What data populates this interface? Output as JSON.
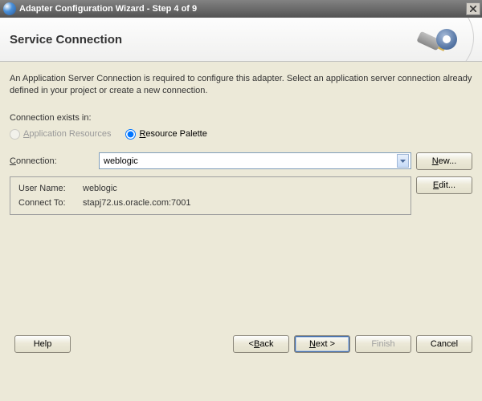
{
  "window": {
    "title": "Adapter Configuration Wizard - Step 4 of 9"
  },
  "banner": {
    "heading": "Service Connection"
  },
  "description": "An Application Server Connection is required to configure this adapter. Select an application server connection already defined in your project or create a new connection.",
  "existsIn": {
    "label": "Connection exists in:",
    "options": {
      "appResources": "Application Resources",
      "resourcePalette": "Resource Palette"
    },
    "selected": "resourcePalette"
  },
  "connection": {
    "label": "Connection:",
    "value": "weblogic"
  },
  "info": {
    "userNameLabel": "User Name:",
    "userNameValue": "weblogic",
    "connectToLabel": "Connect To:",
    "connectToValue": "stapj72.us.oracle.com:7001"
  },
  "buttons": {
    "new": "New...",
    "edit": "Edit...",
    "help": "Help",
    "back": "< Back",
    "next": "Next >",
    "finish": "Finish",
    "cancel": "Cancel"
  }
}
